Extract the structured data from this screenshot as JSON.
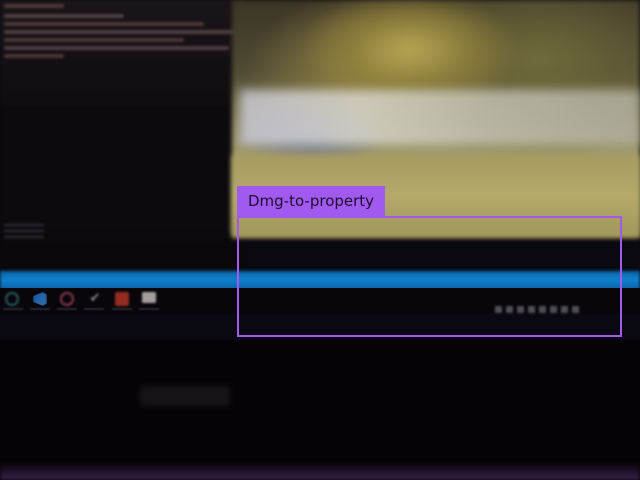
{
  "detections": [
    {
      "label": "Dmg-to-property",
      "color": "#a259f0"
    }
  ],
  "scene": {
    "ui_accent_color": "#0e82d0",
    "taskbar_icons": [
      "search-icon",
      "vscode-icon",
      "media-player-icon",
      "todo-icon",
      "app-icon",
      "app-window-icon"
    ]
  }
}
